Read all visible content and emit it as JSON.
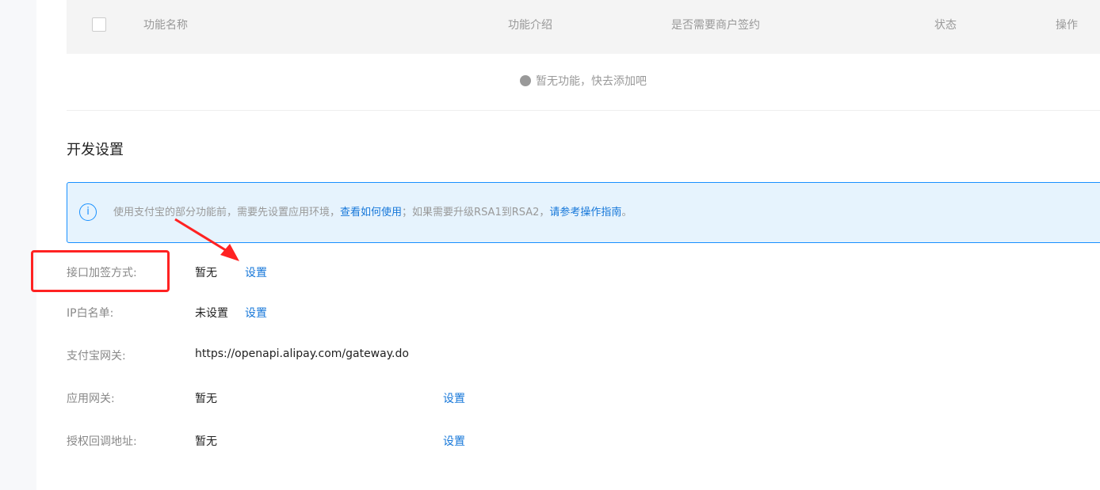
{
  "table": {
    "columns": [
      "功能名称",
      "功能介绍",
      "是否需要商户签约",
      "状态",
      "操作"
    ],
    "empty_text": "暂无功能，快去添加吧"
  },
  "dev": {
    "title": "开发设置",
    "alert": {
      "text1": "使用支付宝的部分功能前，需要先设置应用环境，",
      "link1": "查看如何使用",
      "text2": "；如果需要升级RSA1到RSA2，",
      "link2": "请参考操作指南",
      "text3": "。"
    },
    "rows": [
      {
        "label": "接口加签方式:",
        "value": "暂无",
        "action": "设置"
      },
      {
        "label": "IP白名单:",
        "value": "未设置",
        "action": "设置"
      },
      {
        "label": "支付宝网关:",
        "value": "https://openapi.alipay.com/gateway.do"
      },
      {
        "label": "应用网关:",
        "value": "暂无",
        "action": "设置"
      },
      {
        "label": "授权回调地址:",
        "value": "暂无",
        "action": "设置"
      }
    ]
  },
  "colors": {
    "link": "#1677d9",
    "annotation": "#ff2222"
  }
}
